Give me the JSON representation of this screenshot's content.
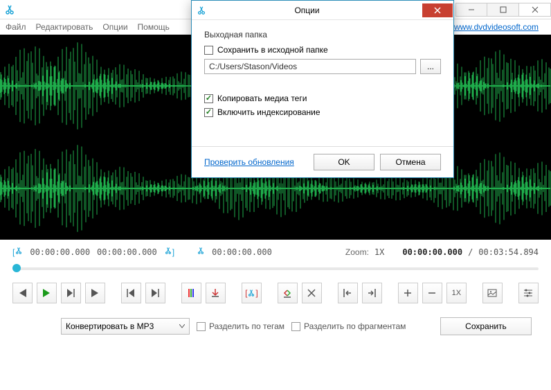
{
  "menus": {
    "file": "Файл",
    "edit": "Редактировать",
    "options": "Опции",
    "help": "Помощь"
  },
  "site_link": "www.dvdvideosoft.com",
  "time": {
    "sel_start": "00:00:00.000",
    "sel_end": "00:00:00.000",
    "cursor": "00:00:00.000",
    "zoom_label": "Zoom:",
    "zoom_val": "1X",
    "current": "00:00:00.000",
    "sep": "/",
    "total": "00:03:54.894"
  },
  "toolbar": {
    "one_x": "1X"
  },
  "bottom": {
    "convert_label": "Конвертировать в MP3",
    "split_tags": "Разделить по тегам",
    "split_frag": "Разделить по фрагментам",
    "save": "Сохранить"
  },
  "dialog": {
    "title": "Опции",
    "out_folder_label": "Выходная папка",
    "save_source": "Сохранить в исходной папке",
    "path": "C:/Users/Stason/Videos",
    "browse": "...",
    "copy_tags": "Копировать медиа теги",
    "indexing": "Включить индексирование",
    "check_updates": "Проверить обновления",
    "ok": "OK",
    "cancel": "Отмена"
  }
}
